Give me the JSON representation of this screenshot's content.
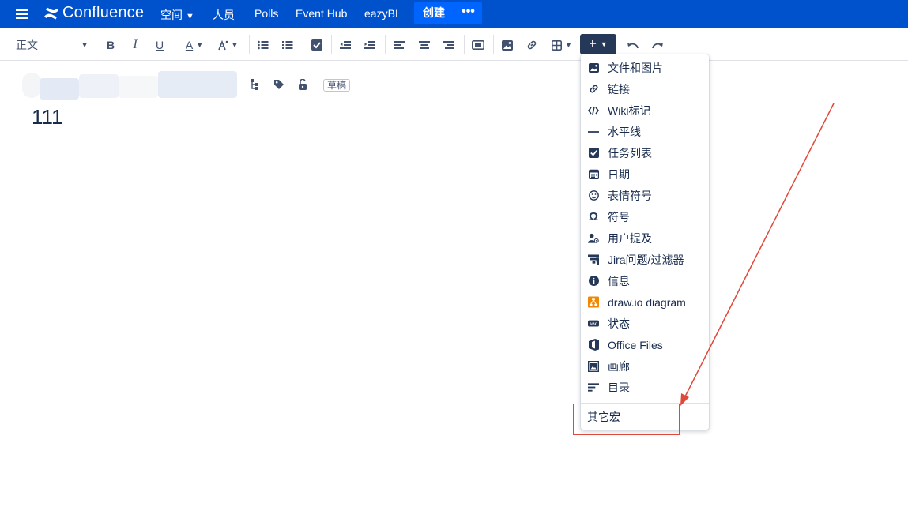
{
  "nav": {
    "product": "Confluence",
    "spaces": "空间",
    "people": "人员",
    "polls": "Polls",
    "event_hub": "Event Hub",
    "eazybi": "eazyBI",
    "create": "创建",
    "more": "•••"
  },
  "toolbar": {
    "paragraph_style": "正文",
    "bold": "B",
    "italic": "I",
    "underline": "U",
    "text_color": "A"
  },
  "page": {
    "status_badge": "草稿",
    "body_text": "111"
  },
  "insert_menu": {
    "items": [
      {
        "label": "文件和图片",
        "icon": "image-icon"
      },
      {
        "label": "链接",
        "icon": "link-icon"
      },
      {
        "label": "Wiki标记",
        "icon": "code-icon"
      },
      {
        "label": "水平线",
        "icon": "horizontal-rule-icon"
      },
      {
        "label": "任务列表",
        "icon": "task-checkbox-icon"
      },
      {
        "label": "日期",
        "icon": "calendar-icon"
      },
      {
        "label": "表情符号",
        "icon": "emoji-icon"
      },
      {
        "label": "符号",
        "icon": "omega-icon"
      },
      {
        "label": "用户提及",
        "icon": "user-mention-icon"
      },
      {
        "label": "Jira问题/过滤器",
        "icon": "jira-icon"
      },
      {
        "label": "信息",
        "icon": "info-icon"
      },
      {
        "label": "draw.io diagram",
        "icon": "drawio-icon"
      },
      {
        "label": "状态",
        "icon": "status-icon"
      },
      {
        "label": "Office Files",
        "icon": "office-icon"
      },
      {
        "label": "画廊",
        "icon": "gallery-icon"
      },
      {
        "label": "目录",
        "icon": "toc-icon"
      }
    ],
    "other_macros": "其它宏"
  },
  "colors": {
    "nav_bg": "#0052cc",
    "create_bg": "#0065ff",
    "annotation": "#e0483a",
    "drawio": "#f08705"
  }
}
